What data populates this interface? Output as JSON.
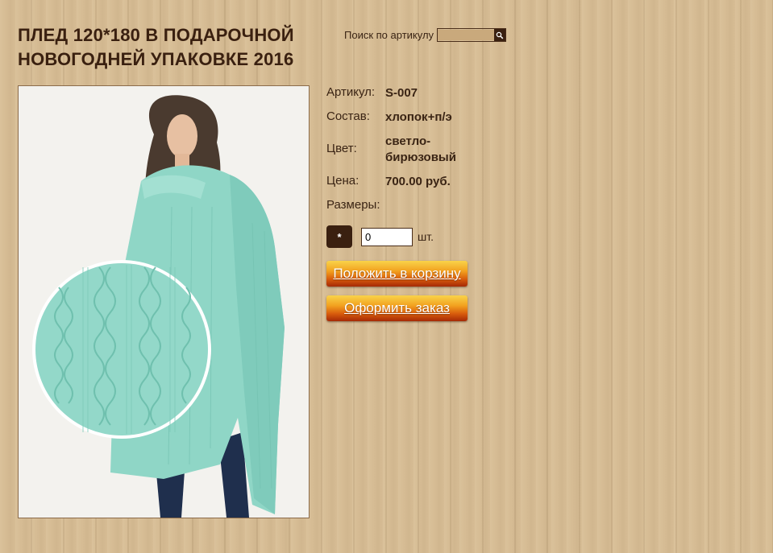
{
  "product": {
    "title": "ПЛЕД 120*180 В ПОДАРОЧНОЙ НОВОГОДНЕЙ УПАКОВКЕ 2016",
    "image_alt": "Плед светло-бирюзовый"
  },
  "search": {
    "label": "Поиск по артикулу",
    "value": "",
    "button_icon": "search-icon"
  },
  "details": {
    "article_label": "Артикул:",
    "article_value": "S-007",
    "composition_label": "Состав:",
    "composition_value": "хлопок+п/э",
    "color_label": "Цвет:",
    "color_value": "светло-бирюзовый",
    "price_label": "Цена:",
    "price_value": "700.00 руб.",
    "sizes_label": "Размеры:"
  },
  "order": {
    "size_option": "*",
    "quantity_value": "0",
    "quantity_unit": "шт.",
    "add_to_cart": "Положить в корзину",
    "checkout": "Оформить заказ"
  },
  "colors": {
    "background": "#d6bc94",
    "text": "#3a2414",
    "button_top": "#f9d34a",
    "button_bottom": "#a52a06",
    "knit": "#8fd6c6"
  }
}
